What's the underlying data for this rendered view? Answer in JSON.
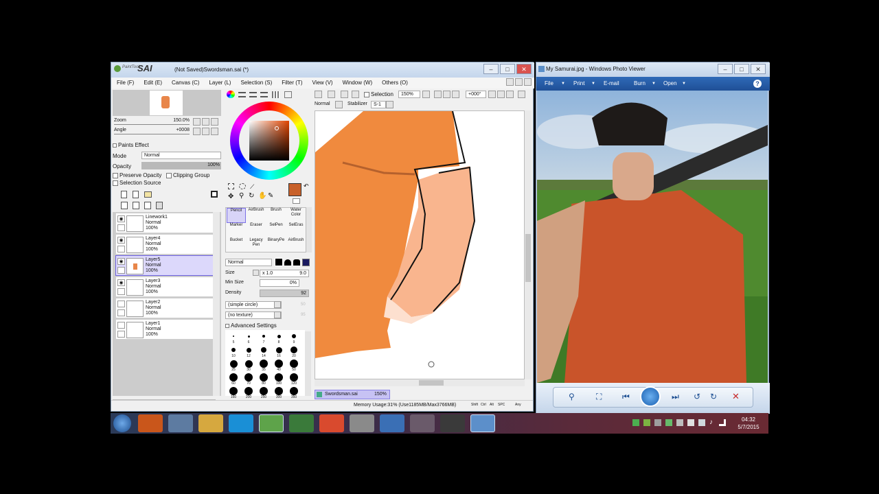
{
  "sai": {
    "title": "(Not Saved)Swordsman.sai (*)",
    "logo_small": "PaintTool",
    "logo_big": "SAI",
    "menu": [
      "File (F)",
      "Edit (E)",
      "Canvas (C)",
      "Layer (L)",
      "Selection (S)",
      "Filter (T)",
      "View (V)",
      "Window (W)",
      "Others (O)"
    ],
    "navigator": {
      "zoom_label": "Zoom",
      "zoom_value": "150.0%",
      "angle_label": "Angle",
      "angle_value": "+0008"
    },
    "layer_props": {
      "paints_effect": "Paints Effect",
      "mode_label": "Mode",
      "mode_value": "Normal",
      "opacity_label": "Opacity",
      "opacity_value": "100%",
      "opacity_level": 1.0,
      "preserve_opacity": "Preserve Opacity",
      "clipping_group": "Clipping Group",
      "selection_source": "Selection Source"
    },
    "layers": [
      {
        "name": "Linework1",
        "mode": "Normal",
        "opacity": "100%",
        "visible": true,
        "selected": false
      },
      {
        "name": "Layer4",
        "mode": "Normal",
        "opacity": "100%",
        "visible": true,
        "selected": false
      },
      {
        "name": "Layer5",
        "mode": "Normal",
        "opacity": "100%",
        "visible": true,
        "selected": true
      },
      {
        "name": "Layer3",
        "mode": "Normal",
        "opacity": "100%",
        "visible": true,
        "selected": false
      },
      {
        "name": "Layer2",
        "mode": "Normal",
        "opacity": "100%",
        "visible": false,
        "selected": false
      },
      {
        "name": "Layer1",
        "mode": "Normal",
        "opacity": "100%",
        "visible": false,
        "selected": false
      }
    ],
    "color": {
      "current": "#c8612a"
    },
    "tools": [
      [
        "Pencil",
        "AirBrush",
        "Brush",
        "Water Color"
      ],
      [
        "Marker",
        "Eraser",
        "SelPen",
        "SelEras"
      ],
      [
        "Bucket",
        "Legacy Pen",
        "BinaryPe",
        "AirBrush"
      ]
    ],
    "brush": {
      "blend": "Normal",
      "size_label": "Size",
      "size_mult": "x 1.0",
      "size_value": "9.0",
      "minsize_label": "Min Size",
      "minsize_value": "0%",
      "density_label": "Density",
      "density_value": "92",
      "shape": "(simple circle)",
      "shape_val": "50",
      "texture": "(no texture)",
      "texture_val": "95",
      "advanced": "Advanced Settings"
    },
    "size_presets": [
      "5",
      "6",
      "7",
      "8",
      "9",
      "10",
      "12",
      "14",
      "16",
      "20",
      "25",
      "30",
      "35",
      "40",
      "50",
      "60",
      "70",
      "80",
      "100",
      "120",
      "160",
      "200",
      "250",
      "300",
      "350"
    ],
    "canvas_toolbar": {
      "selection_label": "Selection",
      "zoom": "150%",
      "rotate": "+000°",
      "blend": "Normal",
      "stabilizer_label": "Stabilizer",
      "stabilizer_value": "S-1"
    },
    "doc_tab": {
      "name": "Swordsman.sai",
      "zoom": "150%"
    },
    "status": {
      "memory": "Memory Usage:31% (Use1185MB/Max3766MB)",
      "keys": [
        "Shift",
        "Ctrl",
        "Alt",
        "SPC",
        "Any"
      ]
    }
  },
  "photo_viewer": {
    "title": "My Samurai.jpg - Windows Photo Viewer",
    "menu": [
      "File",
      "Print",
      "E-mail",
      "Burn",
      "Open"
    ],
    "help_icon": "?"
  },
  "taskbar": {
    "time": "04:32",
    "date": "5/7/2015",
    "app_icons": [
      "start-orb",
      "firefox",
      "calculator",
      "explorer",
      "skype",
      "painttool-sai",
      "app-green",
      "chrome",
      "app-upload",
      "app-blue",
      "pen-tool",
      "app-hat",
      "photo-viewer"
    ]
  }
}
